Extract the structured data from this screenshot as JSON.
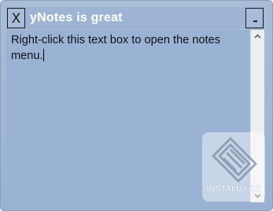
{
  "window": {
    "title": "yNotes is great",
    "close_label": "X"
  },
  "note": {
    "text": "Right-click this text box to open the notes menu."
  },
  "watermark": {
    "text": "INSTALUJ.CZ"
  },
  "colors": {
    "note_background": "#9ab3d5",
    "titlebar_text": "#ffffff",
    "scrollbar_track": "#eeeeee"
  },
  "icons": {
    "close": "close-icon",
    "minimize": "minimize-icon",
    "scroll_up": "scroll-up-arrow-icon",
    "scroll_down": "scroll-down-arrow-icon",
    "watermark_logo": "instaluj-logo-icon"
  }
}
